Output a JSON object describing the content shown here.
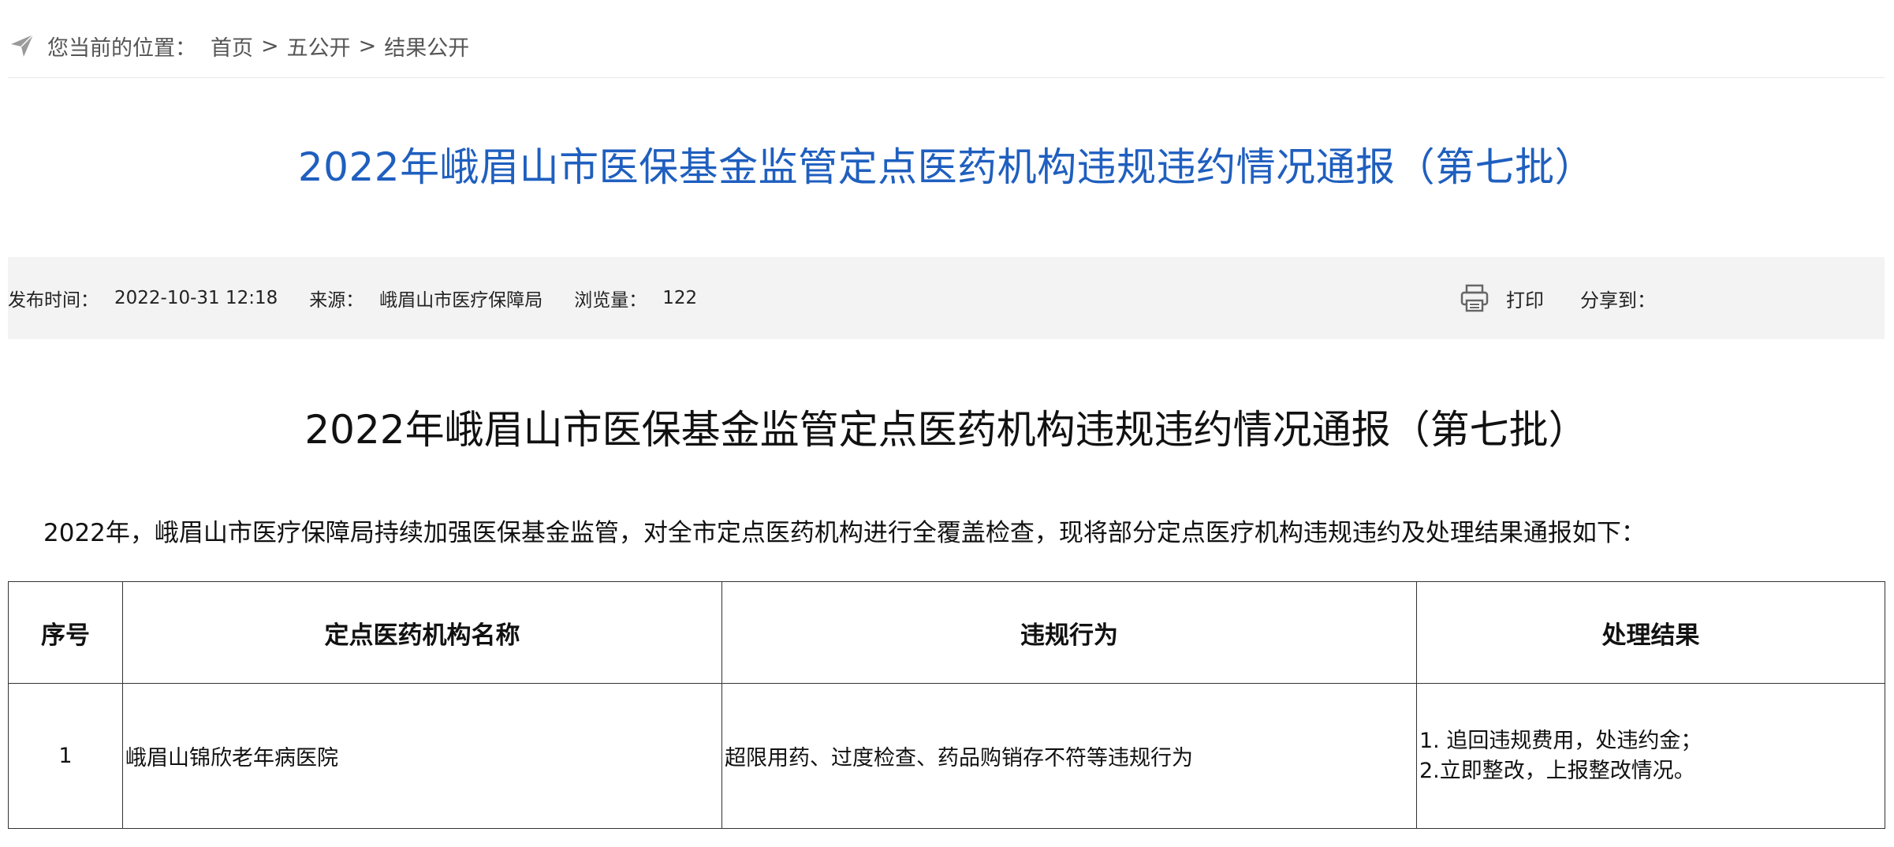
{
  "breadcrumb": {
    "label": "您当前的位置：",
    "items": [
      "首页",
      "五公开",
      "结果公开"
    ],
    "separator": ">"
  },
  "page_title": "2022年峨眉山市医保基金监管定点医药机构违规违约情况通报（第七批）",
  "meta": {
    "publish_time_label": "发布时间：",
    "publish_time": "2022-10-31 12:18",
    "source_label": "来源：",
    "source": "峨眉山市医疗保障局",
    "views_label": "浏览量：",
    "views": "122",
    "print_label": "打印",
    "share_label": "分享到："
  },
  "article": {
    "title": "2022年峨眉山市医保基金监管定点医药机构违规违约情况通报（第七批）",
    "intro": "2022年，峨眉山市医疗保障局持续加强医保基金监管，对全市定点医药机构进行全覆盖检查，现将部分定点医疗机构违规违约及处理结果通报如下："
  },
  "table": {
    "headers": [
      "序号",
      "定点医药机构名称",
      "违规行为",
      "处理结果"
    ],
    "rows": [
      {
        "index": "1",
        "name": "峨眉山锦欣老年病医院",
        "violation": "超限用药、过度检查、药品购销存不符等违规行为",
        "result_lines": [
          "1. 追回违规费用，处违约金；",
          "2.立即整改，上报整改情况。"
        ]
      }
    ]
  },
  "colors": {
    "title_blue": "#1f5fbf",
    "meta_bg": "#f3f3f3"
  },
  "icons": [
    "location-arrow-icon",
    "printer-icon"
  ]
}
